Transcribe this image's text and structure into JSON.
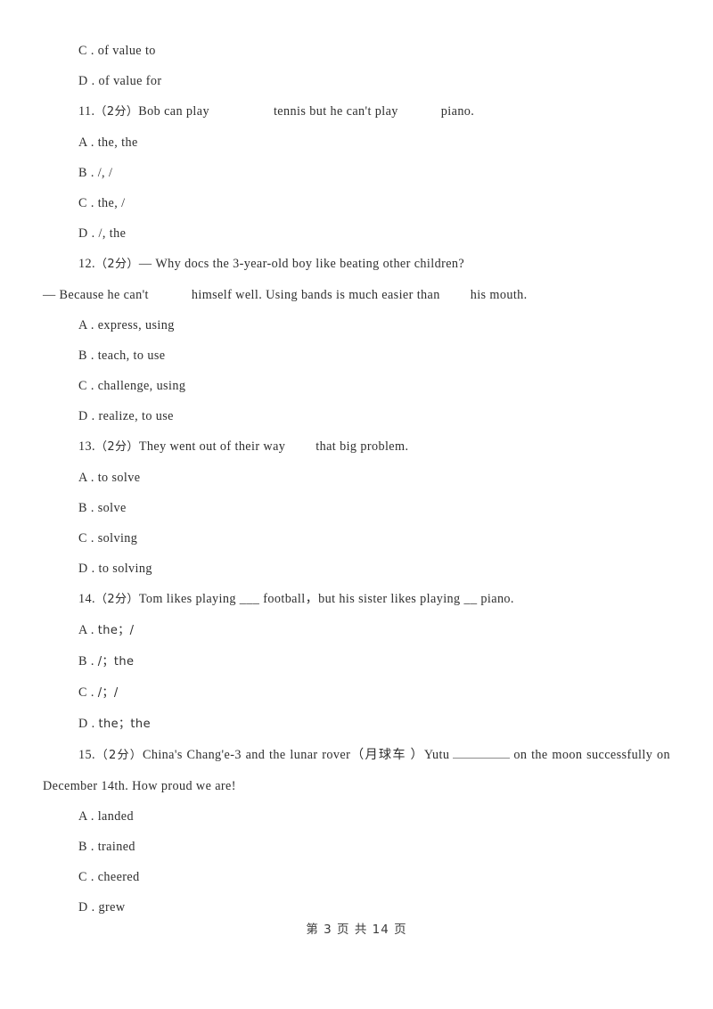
{
  "document": {
    "page_label_prefix": "第",
    "page_number": "3",
    "page_label_middle": "页 共",
    "total_pages": "14",
    "page_label_suffix": "页",
    "footer_text": "第 3 页 共 14 页",
    "background_color": "#ffffff",
    "text_color": "#2e2e2e"
  },
  "carryover_options": [
    {
      "label": "C",
      "sep": " . ",
      "text": "of value to"
    },
    {
      "label": "D",
      "sep": " . ",
      "text": "of value for"
    }
  ],
  "questions": [
    {
      "number": "11.",
      "points": "（2分）",
      "stem_part1": "Bob can play",
      "stem_part2": "tennis but he can't play",
      "stem_part3": "piano.",
      "options": [
        {
          "label": "A",
          "sep": " . ",
          "text": "the, the"
        },
        {
          "label": "B",
          "sep": " . ",
          "text": "/, /"
        },
        {
          "label": "C",
          "sep": " . ",
          "text": "the, /"
        },
        {
          "label": "D",
          "sep": " . ",
          "text": "/, the"
        }
      ]
    },
    {
      "number": "12.",
      "points": "（2分）",
      "stem_line1": "— Why docs the 3-year-old boy like beating other children?",
      "stem_line2_part1": "— Because he can't",
      "stem_line2_part2": "himself well. Using bands is much easier than",
      "stem_line2_part3": "his mouth.",
      "options": [
        {
          "label": "A",
          "sep": " . ",
          "text": "express, using"
        },
        {
          "label": "B",
          "sep": " . ",
          "text": "teach, to use"
        },
        {
          "label": "C",
          "sep": " . ",
          "text": "challenge, using"
        },
        {
          "label": "D",
          "sep": " . ",
          "text": "realize, to use"
        }
      ]
    },
    {
      "number": "13.",
      "points": "（2分）",
      "stem_part1": "They went out of their way",
      "stem_part2": "that big problem.",
      "options": [
        {
          "label": "A",
          "sep": " . ",
          "text": "to solve"
        },
        {
          "label": "B",
          "sep": " . ",
          "text": "solve"
        },
        {
          "label": "C",
          "sep": " . ",
          "text": "solving"
        },
        {
          "label": "D",
          "sep": " . ",
          "text": "to solving"
        }
      ]
    },
    {
      "number": "14.",
      "points": "（2分）",
      "stem_full": "Tom likes playing ___ football，but his sister likes playing __ piano.",
      "options": [
        {
          "label": "A",
          "sep": " . ",
          "text": "the；/"
        },
        {
          "label": "B",
          "sep": " . ",
          "text": "/；the"
        },
        {
          "label": "C",
          "sep": " . ",
          "text": "/；/"
        },
        {
          "label": "D",
          "sep": " . ",
          "text": "the；the"
        }
      ]
    },
    {
      "number": "15.",
      "points": "（2分）",
      "stem_part1": "China's Chang'e-3 and the lunar rover（月球车 ）Yutu",
      "stem_part2": "on the moon successfully on December 14th. How proud we are!",
      "options": [
        {
          "label": "A",
          "sep": " . ",
          "text": "landed"
        },
        {
          "label": "B",
          "sep": " . ",
          "text": "trained"
        },
        {
          "label": "C",
          "sep": " . ",
          "text": "cheered"
        },
        {
          "label": "D",
          "sep": " . ",
          "text": "grew"
        }
      ]
    }
  ]
}
